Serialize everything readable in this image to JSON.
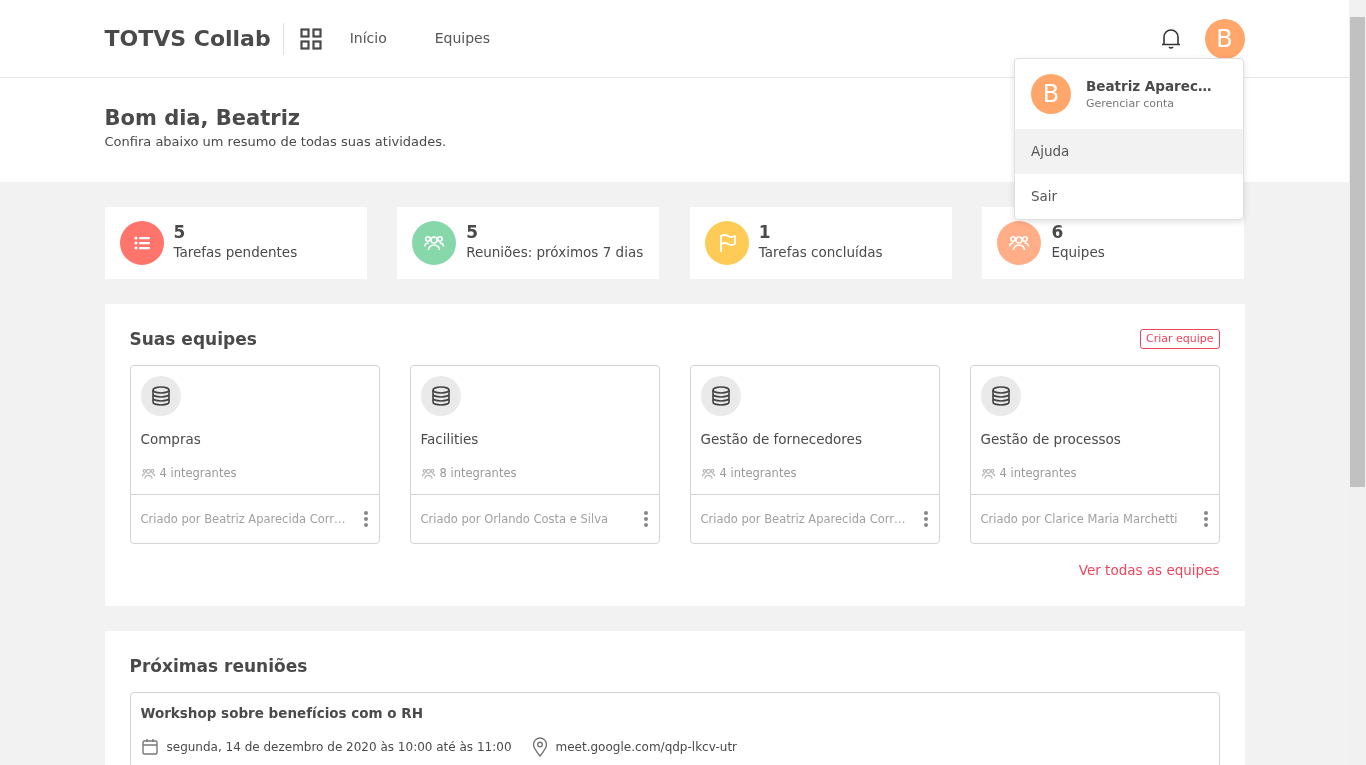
{
  "header": {
    "brand": "TOTVS Collab",
    "nav": [
      {
        "label": "Início",
        "selected": false
      },
      {
        "label": "Equipes",
        "selected": false
      }
    ],
    "avatar_letter": "B"
  },
  "user_menu": {
    "avatar_letter": "B",
    "name": "Beatriz Aparec…",
    "subtitle": "Gerenciar conta",
    "items": [
      {
        "label": "Ajuda",
        "selected": true
      },
      {
        "label": "Sair",
        "selected": false
      }
    ]
  },
  "greeting": {
    "title": "Bom dia, Beatriz",
    "subtitle": "Confira abaixo um resumo de todas suas atividades."
  },
  "stats": [
    {
      "kind": "list",
      "color": "#ff746b",
      "value": "5",
      "label": "Tarefas pendentes"
    },
    {
      "kind": "people",
      "color": "#86d7aa",
      "value": "5",
      "label": "Reuniões: próximos 7 dias"
    },
    {
      "kind": "flag",
      "color": "#ffcb57",
      "value": "1",
      "label": "Tarefas concluídas"
    },
    {
      "kind": "people",
      "color": "#ffae87",
      "value": "6",
      "label": "Equipes"
    }
  ],
  "teams": {
    "title": "Suas equipes",
    "create_button": "Criar equipe",
    "see_all": "Ver todas as equipes",
    "items": [
      {
        "name": "Compras",
        "members": "4 integrantes",
        "created_by": "Criado por Beatriz Aparecida Corr…"
      },
      {
        "name": "Facilities",
        "members": "8 integrantes",
        "created_by": "Criado por Orlando Costa e Silva"
      },
      {
        "name": "Gestão de fornecedores",
        "members": "4 integrantes",
        "created_by": "Criado por Beatriz Aparecida Corr…"
      },
      {
        "name": "Gestão de processos",
        "members": "4 integrantes",
        "created_by": "Criado por Clarice Maria Marchetti"
      }
    ]
  },
  "meetings": {
    "title": "Próximas reuniões",
    "items": [
      {
        "title": "Workshop sobre benefícios com o RH",
        "when": "segunda, 14 de dezembro de 2020 às 10:00 até às 11:00",
        "where": "meet.google.com/qdp-lkcv-utr"
      }
    ]
  }
}
